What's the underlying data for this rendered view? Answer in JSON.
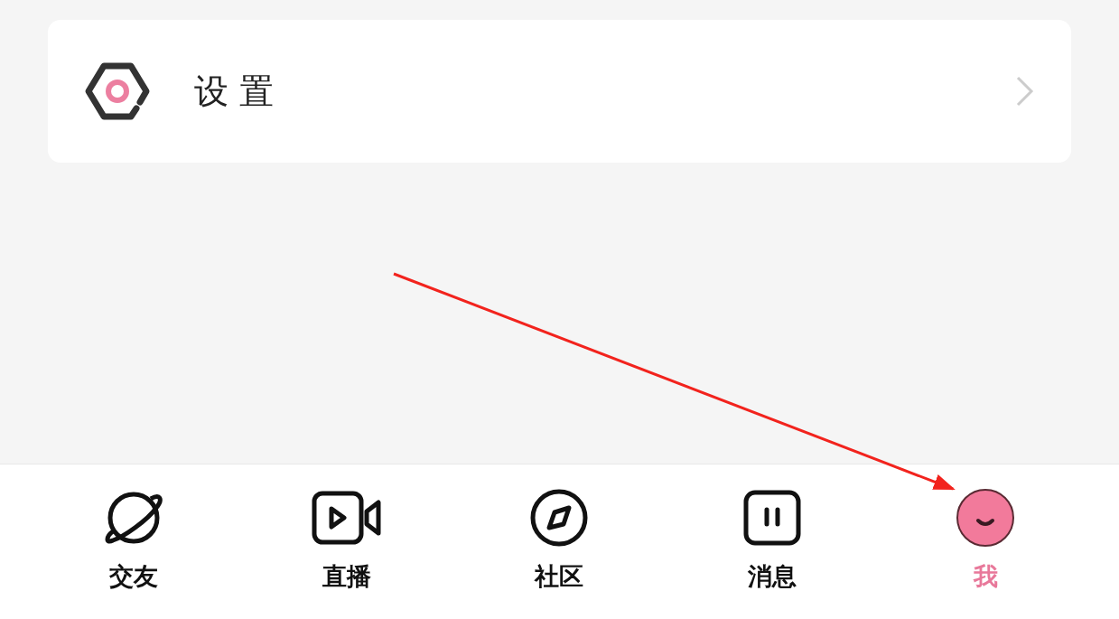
{
  "settings_row": {
    "label": "设置"
  },
  "tabs": [
    {
      "label": "交友",
      "kind": "planet",
      "selected": false
    },
    {
      "label": "直播",
      "kind": "video",
      "selected": false
    },
    {
      "label": "社区",
      "kind": "compass",
      "selected": false
    },
    {
      "label": "消息",
      "kind": "message",
      "selected": false
    },
    {
      "label": "我",
      "kind": "me",
      "selected": true
    }
  ]
}
